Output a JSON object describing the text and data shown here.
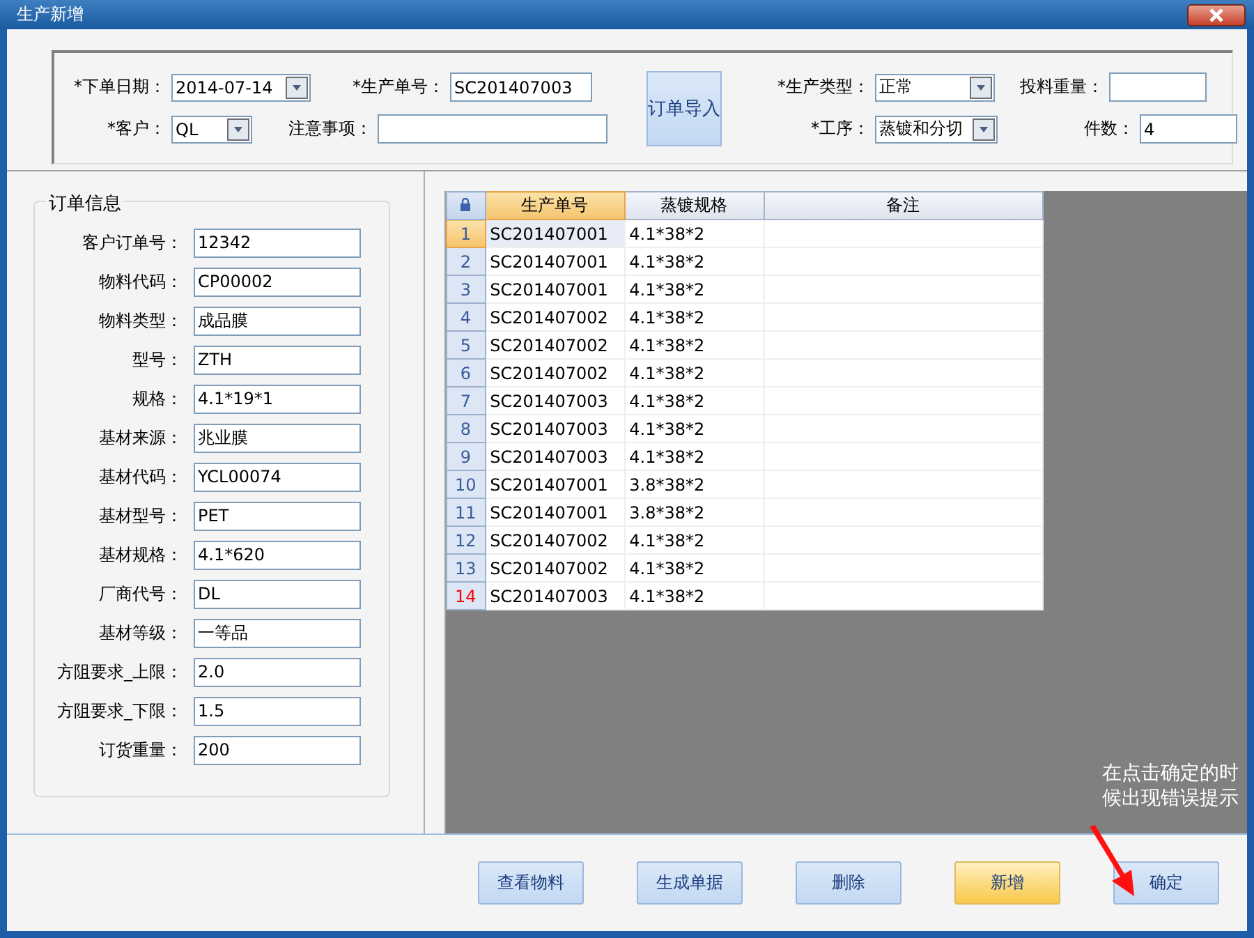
{
  "window": {
    "title": "生产新增"
  },
  "header": {
    "rows": [
      [
        {
          "label": "*下单日期：",
          "value": "2014-07-14",
          "kind": "dropdown"
        },
        {
          "label": "*生产单号：",
          "value": "SC201407003",
          "kind": "text"
        },
        {
          "label": "*生产类型：",
          "value": "正常",
          "kind": "dropdown"
        },
        {
          "label": "投料重量：",
          "kind": "text"
        }
      ],
      [
        {
          "label": "*客户：",
          "value": "QL",
          "kind": "dropdown"
        },
        {
          "label": "注意事项：",
          "kind": "text"
        },
        {
          "label": "*工序：",
          "value": "蒸镀和分切",
          "kind": "dropdown"
        },
        {
          "label": "件数：",
          "value": "4",
          "kind": "text"
        }
      ]
    ],
    "import_button": "订单导入"
  },
  "order_info": {
    "title": "订单信息",
    "fields": [
      {
        "label": "客户订单号：",
        "value": "12342"
      },
      {
        "label": "物料代码：",
        "value": "CP00002"
      },
      {
        "label": "物料类型：",
        "value": "成品膜"
      },
      {
        "label": "型号：",
        "value": "ZTH"
      },
      {
        "label": "规格：",
        "value": "4.1*19*1"
      },
      {
        "label": "基材来源：",
        "value": "兆业膜"
      },
      {
        "label": "基材代码：",
        "value": "YCL00074"
      },
      {
        "label": "基材型号：",
        "value": "PET"
      },
      {
        "label": "基材规格：",
        "value": "4.1*620"
      },
      {
        "label": "厂商代号：",
        "value": "DL"
      },
      {
        "label": "基材等级：",
        "value": "一等品"
      },
      {
        "label": "方阻要求_上限：",
        "value": "2.0"
      },
      {
        "label": "方阻要求_下限：",
        "value": "1.5"
      },
      {
        "label": "订货重量：",
        "value": "200"
      }
    ]
  },
  "table": {
    "columns": [
      "生产单号",
      "蒸镀规格",
      "备注"
    ],
    "rows": [
      {
        "number": "1",
        "cells": [
          "SC201407001",
          "4.1*38*2"
        ],
        "selected": true,
        "flagged": false
      },
      {
        "number": "2",
        "cells": [
          "SC201407001",
          "4.1*38*2"
        ],
        "selected": false,
        "flagged": false
      },
      {
        "number": "3",
        "cells": [
          "SC201407001",
          "4.1*38*2"
        ],
        "selected": false,
        "flagged": false
      },
      {
        "number": "4",
        "cells": [
          "SC201407002",
          "4.1*38*2"
        ],
        "selected": false,
        "flagged": false
      },
      {
        "number": "5",
        "cells": [
          "SC201407002",
          "4.1*38*2"
        ],
        "selected": false,
        "flagged": false
      },
      {
        "number": "6",
        "cells": [
          "SC201407002",
          "4.1*38*2"
        ],
        "selected": false,
        "flagged": false
      },
      {
        "number": "7",
        "cells": [
          "SC201407003",
          "4.1*38*2"
        ],
        "selected": false,
        "flagged": false
      },
      {
        "number": "8",
        "cells": [
          "SC201407003",
          "4.1*38*2"
        ],
        "selected": false,
        "flagged": false
      },
      {
        "number": "9",
        "cells": [
          "SC201407003",
          "4.1*38*2"
        ],
        "selected": false,
        "flagged": false
      },
      {
        "number": "10",
        "cells": [
          "SC201407001",
          "3.8*38*2"
        ],
        "selected": false,
        "flagged": false
      },
      {
        "number": "11",
        "cells": [
          "SC201407001",
          "3.8*38*2"
        ],
        "selected": false,
        "flagged": false
      },
      {
        "number": "12",
        "cells": [
          "SC201407002",
          "4.1*38*2"
        ],
        "selected": false,
        "flagged": false
      },
      {
        "number": "13",
        "cells": [
          "SC201407002",
          "4.1*38*2"
        ],
        "selected": false,
        "flagged": false
      },
      {
        "number": "14",
        "cells": [
          "SC201407003",
          "4.1*38*2"
        ],
        "selected": false,
        "flagged": true
      }
    ]
  },
  "annotation": "在点击确定的时候出现错误提示",
  "buttons": [
    {
      "label": "查看物料",
      "highlighted": false
    },
    {
      "label": "生成单据",
      "highlighted": false
    },
    {
      "label": "删除",
      "highlighted": false
    },
    {
      "label": "新增",
      "highlighted": true
    },
    {
      "label": "确定",
      "highlighted": false
    }
  ]
}
